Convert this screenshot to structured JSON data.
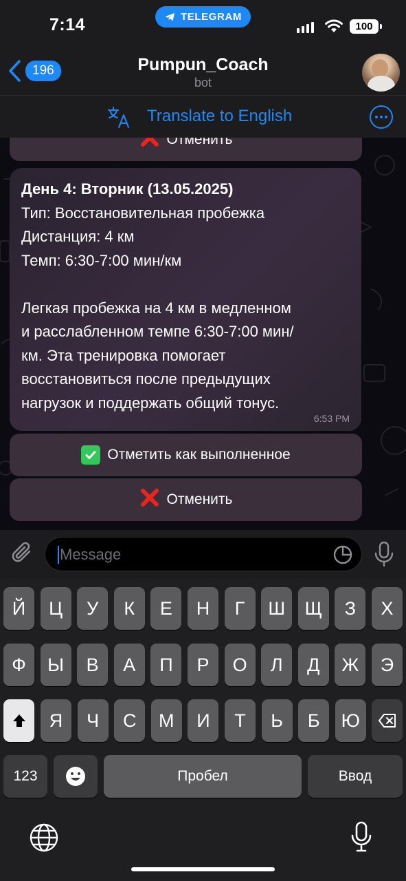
{
  "status_bar": {
    "time": "7:14",
    "app_pill": "TELEGRAM",
    "battery": "100"
  },
  "header": {
    "back_count": "196",
    "title": "Pumpun_Coach",
    "subtitle": "bot"
  },
  "translate_bar": {
    "label": "Translate to English"
  },
  "chat": {
    "top_button_label": "Отменить",
    "message": {
      "line1": "День 4: Вторник (13.05.2025)",
      "line2": "Тип: Восстановительная пробежка",
      "line3": "Дистанция: 4 км",
      "line4": "Темп: 6:30-7:00 мин/км",
      "para_line1": "Легкая пробежка на 4 км в медленном",
      "para_line2": "и расслабленном темпе 6:30-7:00 мин/",
      "para_line3": "км. Эта тренировка помогает",
      "para_line4": "восстановиться после предыдущих",
      "para_line5": "нагрузок и поддержать общий тонус.",
      "time": "6:53 PM"
    },
    "buttons": {
      "mark_done": "Отметить как выполненное",
      "cancel": "Отменить"
    }
  },
  "input": {
    "placeholder": "Message"
  },
  "keyboard": {
    "row1": [
      "Й",
      "Ц",
      "У",
      "К",
      "Е",
      "Н",
      "Г",
      "Ш",
      "Щ",
      "З",
      "Х"
    ],
    "row2": [
      "Ф",
      "Ы",
      "В",
      "А",
      "П",
      "Р",
      "О",
      "Л",
      "Д",
      "Ж",
      "Э"
    ],
    "row3": [
      "Я",
      "Ч",
      "С",
      "М",
      "И",
      "Т",
      "Ь",
      "Б",
      "Ю"
    ],
    "numbers": "123",
    "space": "Пробел",
    "return": "Ввод"
  },
  "colors": {
    "accent": "#1e88f5",
    "bar_bg": "#1c1c1e",
    "inline_button": "#3a2f3a"
  }
}
